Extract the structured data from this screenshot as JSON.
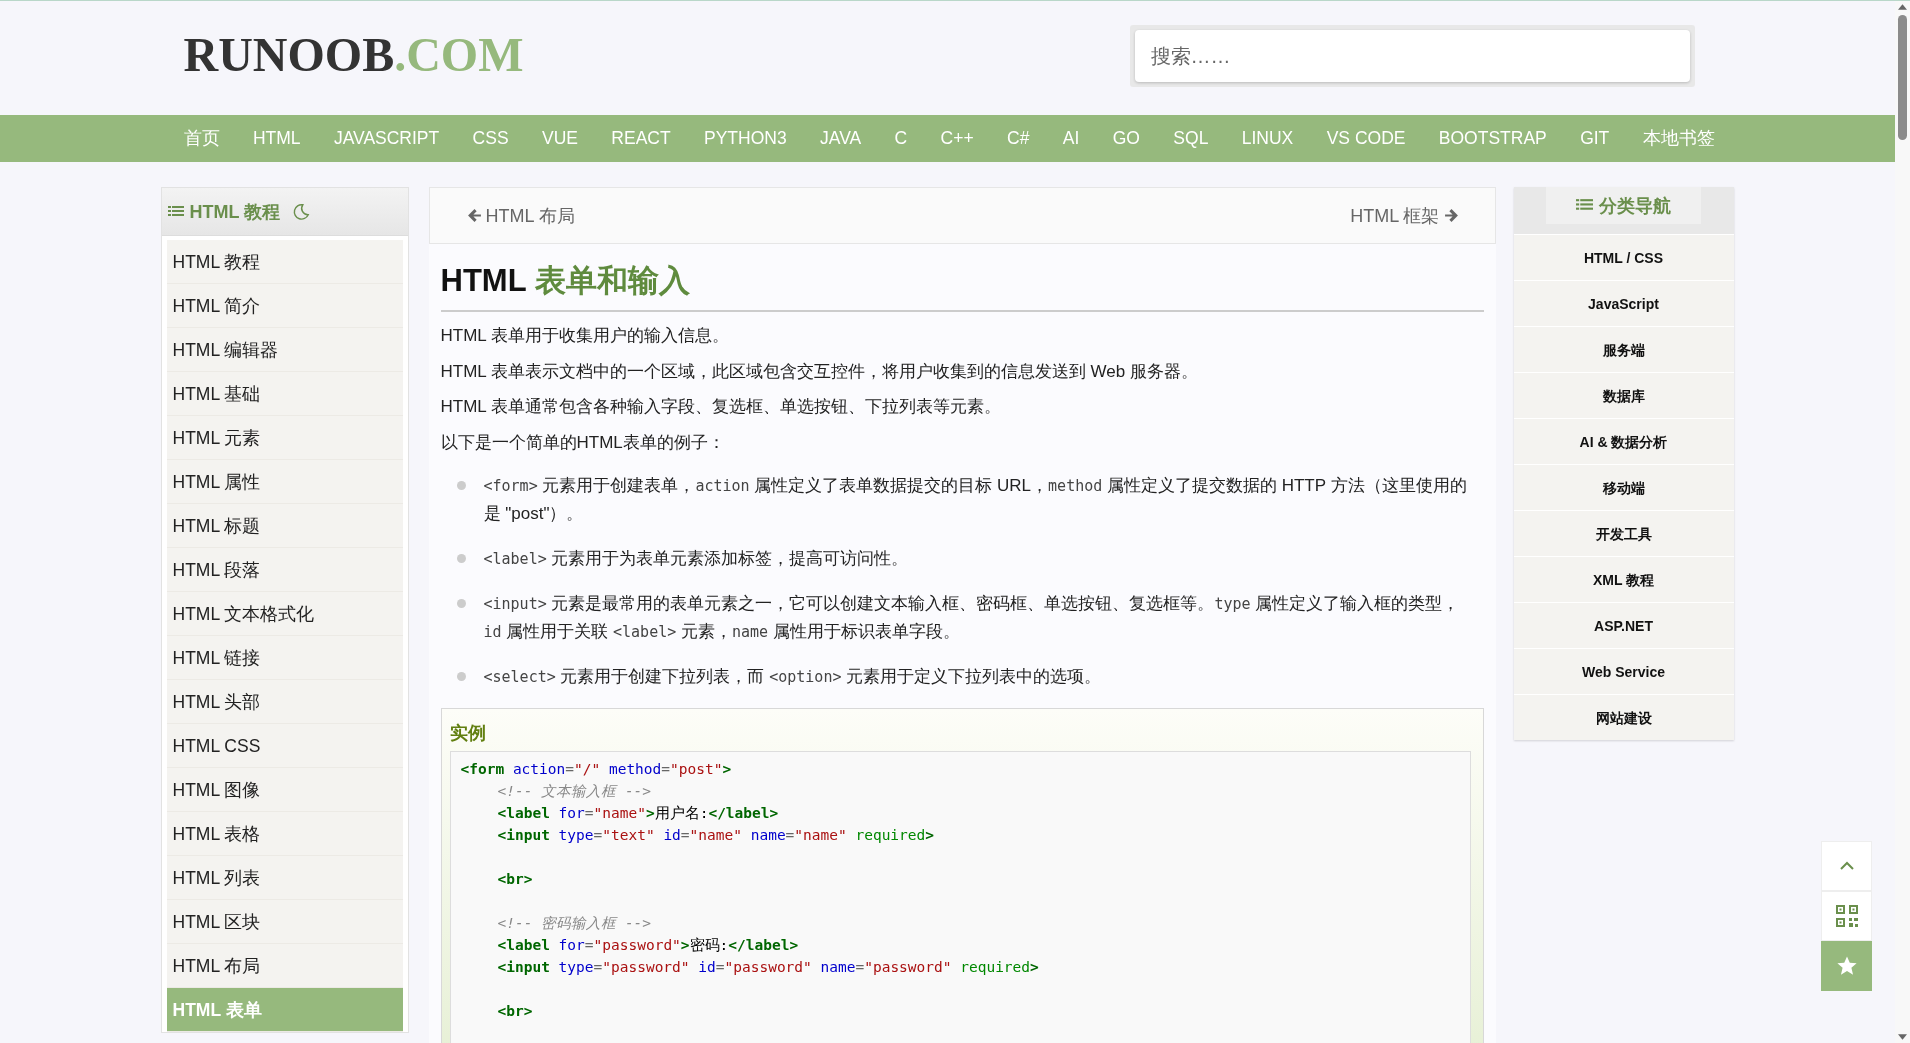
{
  "logo": {
    "name": "RUNOOB",
    "suffix": ".COM"
  },
  "search": {
    "placeholder": "搜索……"
  },
  "nav": [
    {
      "label": "首页"
    },
    {
      "label": "HTML"
    },
    {
      "label": "JAVASCRIPT"
    },
    {
      "label": "CSS"
    },
    {
      "label": "VUE"
    },
    {
      "label": "REACT"
    },
    {
      "label": "PYTHON3"
    },
    {
      "label": "JAVA"
    },
    {
      "label": "C"
    },
    {
      "label": "C++"
    },
    {
      "label": "C#"
    },
    {
      "label": "AI"
    },
    {
      "label": "GO"
    },
    {
      "label": "SQL"
    },
    {
      "label": "LINUX"
    },
    {
      "label": "VS CODE"
    },
    {
      "label": "BOOTSTRAP"
    },
    {
      "label": "GIT"
    },
    {
      "label": "本地书签"
    }
  ],
  "sidebar": {
    "title": "HTML 教程",
    "items": [
      {
        "label": "HTML 教程",
        "selected": false
      },
      {
        "label": "HTML 简介",
        "selected": false
      },
      {
        "label": "HTML 编辑器",
        "selected": false
      },
      {
        "label": "HTML 基础",
        "selected": false
      },
      {
        "label": "HTML 元素",
        "selected": false
      },
      {
        "label": "HTML 属性",
        "selected": false
      },
      {
        "label": "HTML 标题",
        "selected": false
      },
      {
        "label": "HTML 段落",
        "selected": false
      },
      {
        "label": "HTML 文本格式化",
        "selected": false
      },
      {
        "label": "HTML 链接",
        "selected": false
      },
      {
        "label": "HTML 头部",
        "selected": false
      },
      {
        "label": "HTML CSS",
        "selected": false
      },
      {
        "label": "HTML 图像",
        "selected": false
      },
      {
        "label": "HTML 表格",
        "selected": false
      },
      {
        "label": "HTML 列表",
        "selected": false
      },
      {
        "label": "HTML 区块",
        "selected": false
      },
      {
        "label": "HTML 布局",
        "selected": false
      },
      {
        "label": "HTML 表单",
        "selected": true
      }
    ]
  },
  "pager": {
    "prev": "HTML 布局",
    "next": "HTML 框架"
  },
  "heading": [
    {
      "text": "HTML",
      "kind": "plain"
    },
    {
      "text": "表单和输入",
      "kind": "accent"
    }
  ],
  "paragraphs": [
    "HTML 表单用于收集用户的输入信息。",
    "HTML 表单表示文档中的一个区域，此区域包含交互控件，将用户收集到的信息发送到 Web 服务器。",
    "HTML 表单通常包含各种输入字段、复选框、单选按钮、下拉列表等元素。",
    "以下是一个简单的HTML表单的例子："
  ],
  "bullets": [
    [
      {
        "kind": "code",
        "text": "<form>"
      },
      {
        "kind": "text",
        "text": " 元素用于创建表单，"
      },
      {
        "kind": "code",
        "text": "action"
      },
      {
        "kind": "text",
        "text": " 属性定义了表单数据提交的目标 URL，"
      },
      {
        "kind": "code",
        "text": "method"
      },
      {
        "kind": "text",
        "text": " 属性定义了提交数据的 HTTP 方法（这里使用的是 \"post\"）。"
      }
    ],
    [
      {
        "kind": "code",
        "text": "<label>"
      },
      {
        "kind": "text",
        "text": " 元素用于为表单元素添加标签，提高可访问性。"
      }
    ],
    [
      {
        "kind": "code",
        "text": "<input>"
      },
      {
        "kind": "text",
        "text": " 元素是最常用的表单元素之一，它可以创建文本输入框、密码框、单选按钮、复选框等。"
      },
      {
        "kind": "code",
        "text": "type"
      },
      {
        "kind": "text",
        "text": " 属性定义了输入框的类型，"
      },
      {
        "kind": "code",
        "text": "id"
      },
      {
        "kind": "text",
        "text": " 属性用于关联 "
      },
      {
        "kind": "code",
        "text": "<label>"
      },
      {
        "kind": "text",
        "text": " 元素，"
      },
      {
        "kind": "code",
        "text": "name"
      },
      {
        "kind": "text",
        "text": " 属性用于标识表单字段。"
      }
    ],
    [
      {
        "kind": "code",
        "text": "<select>"
      },
      {
        "kind": "text",
        "text": " 元素用于创建下拉列表，而 "
      },
      {
        "kind": "code",
        "text": "<option>"
      },
      {
        "kind": "text",
        "text": " 元素用于定义下拉列表中的选项。"
      }
    ]
  ],
  "example": {
    "title": "实例",
    "lines": [
      {
        "kind": "code",
        "indented": false,
        "tokens": [
          {
            "kind": "tag",
            "text": "<form"
          },
          {
            "kind": "attr",
            "text": "action"
          },
          {
            "kind": "punct",
            "text": "="
          },
          {
            "kind": "value",
            "text": "\"/\""
          },
          {
            "kind": "attr",
            "text": "method"
          },
          {
            "kind": "punct",
            "text": "="
          },
          {
            "kind": "value",
            "text": "\"post\""
          },
          {
            "kind": "tag",
            "text": ">"
          }
        ]
      },
      {
        "kind": "code",
        "indented": true,
        "tokens": [
          {
            "kind": "comment",
            "text": "<!-- 文本输入框 -->"
          }
        ]
      },
      {
        "kind": "code",
        "indented": true,
        "tokens": [
          {
            "kind": "tag",
            "text": "<label"
          },
          {
            "kind": "attr",
            "text": "for"
          },
          {
            "kind": "punct",
            "text": "="
          },
          {
            "kind": "value",
            "text": "\"name\""
          },
          {
            "kind": "tag",
            "text": ">"
          },
          {
            "kind": "plain",
            "text": "用户名:"
          },
          {
            "kind": "tag",
            "text": "</label>"
          }
        ]
      },
      {
        "kind": "code",
        "indented": true,
        "tokens": [
          {
            "kind": "tag",
            "text": "<input"
          },
          {
            "kind": "attr",
            "text": "type"
          },
          {
            "kind": "punct",
            "text": "="
          },
          {
            "kind": "value",
            "text": "\"text\""
          },
          {
            "kind": "attr",
            "text": "id"
          },
          {
            "kind": "punct",
            "text": "="
          },
          {
            "kind": "value",
            "text": "\"name\""
          },
          {
            "kind": "attr",
            "text": "name"
          },
          {
            "kind": "punct",
            "text": "="
          },
          {
            "kind": "value",
            "text": "\"name\""
          },
          {
            "kind": "flag",
            "text": "required"
          },
          {
            "kind": "tag",
            "text": ">"
          }
        ]
      },
      {
        "kind": "blank"
      },
      {
        "kind": "code",
        "indented": true,
        "tokens": [
          {
            "kind": "tag",
            "text": "<br>"
          }
        ]
      },
      {
        "kind": "blank"
      },
      {
        "kind": "code",
        "indented": true,
        "tokens": [
          {
            "kind": "comment",
            "text": "<!-- 密码输入框 -->"
          }
        ]
      },
      {
        "kind": "code",
        "indented": true,
        "tokens": [
          {
            "kind": "tag",
            "text": "<label"
          },
          {
            "kind": "attr",
            "text": "for"
          },
          {
            "kind": "punct",
            "text": "="
          },
          {
            "kind": "value",
            "text": "\"password\""
          },
          {
            "kind": "tag",
            "text": ">"
          },
          {
            "kind": "plain",
            "text": "密码:"
          },
          {
            "kind": "tag",
            "text": "</label>"
          }
        ]
      },
      {
        "kind": "code",
        "indented": true,
        "tokens": [
          {
            "kind": "tag",
            "text": "<input"
          },
          {
            "kind": "attr",
            "text": "type"
          },
          {
            "kind": "punct",
            "text": "="
          },
          {
            "kind": "value",
            "text": "\"password\""
          },
          {
            "kind": "attr",
            "text": "id"
          },
          {
            "kind": "punct",
            "text": "="
          },
          {
            "kind": "value",
            "text": "\"password\""
          },
          {
            "kind": "attr",
            "text": "name"
          },
          {
            "kind": "punct",
            "text": "="
          },
          {
            "kind": "value",
            "text": "\"password\""
          },
          {
            "kind": "flag",
            "text": "required"
          },
          {
            "kind": "tag",
            "text": ">"
          }
        ]
      },
      {
        "kind": "blank"
      },
      {
        "kind": "code",
        "indented": true,
        "tokens": [
          {
            "kind": "tag",
            "text": "<br>"
          }
        ]
      }
    ]
  },
  "categories": {
    "title": "分类导航",
    "items": [
      "HTML / CSS",
      "JavaScript",
      "服务端",
      "数据库",
      "AI & 数据分析",
      "移动端",
      "开发工具",
      "XML 教程",
      "ASP.NET",
      "Web Service",
      "网站建设"
    ]
  }
}
